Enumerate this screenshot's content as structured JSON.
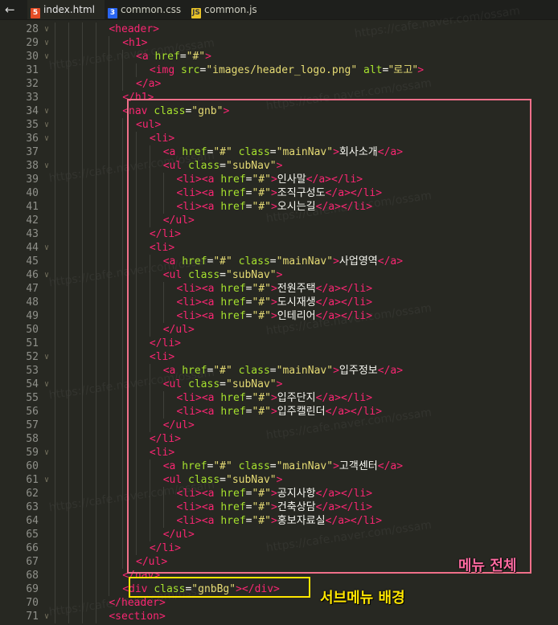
{
  "tabs": {
    "back_icon": "←",
    "items": [
      {
        "label": "index.html",
        "icon": "html-file-icon",
        "glyph": "5",
        "active": true
      },
      {
        "label": "common.css",
        "icon": "css-file-icon",
        "glyph": "3",
        "active": false
      },
      {
        "label": "common.js",
        "icon": "js-file-icon",
        "glyph": "JS",
        "active": false
      }
    ]
  },
  "editor": {
    "fold_glyph": "∨",
    "lines": [
      {
        "n": "28",
        "indent": 8,
        "fold": true,
        "tokens": [
          [
            "t",
            "<header>"
          ]
        ]
      },
      {
        "n": "29",
        "indent": 10,
        "fold": true,
        "tokens": [
          [
            "t",
            "<h1>"
          ]
        ]
      },
      {
        "n": "30",
        "indent": 12,
        "fold": true,
        "tokens": [
          [
            "t",
            "<a "
          ],
          [
            "a",
            "href"
          ],
          [
            "w",
            "="
          ],
          [
            "s",
            "\"#\""
          ],
          [
            "t",
            ">"
          ]
        ]
      },
      {
        "n": "31",
        "indent": 14,
        "fold": false,
        "tokens": [
          [
            "t",
            "<img "
          ],
          [
            "a",
            "src"
          ],
          [
            "w",
            "="
          ],
          [
            "s",
            "\"images/header_logo.png\""
          ],
          [
            "w",
            " "
          ],
          [
            "a",
            "alt"
          ],
          [
            "w",
            "="
          ],
          [
            "s",
            "\"로고\""
          ],
          [
            "t",
            ">"
          ]
        ]
      },
      {
        "n": "32",
        "indent": 12,
        "fold": false,
        "tokens": [
          [
            "t",
            "</a>"
          ]
        ]
      },
      {
        "n": "33",
        "indent": 10,
        "fold": false,
        "tokens": [
          [
            "t",
            "</h1>"
          ]
        ]
      },
      {
        "n": "34",
        "indent": 10,
        "fold": true,
        "tokens": [
          [
            "t",
            "<nav "
          ],
          [
            "a",
            "class"
          ],
          [
            "w",
            "="
          ],
          [
            "s",
            "\"gnb\""
          ],
          [
            "t",
            ">"
          ]
        ]
      },
      {
        "n": "35",
        "indent": 12,
        "fold": true,
        "tokens": [
          [
            "t",
            "<ul>"
          ]
        ]
      },
      {
        "n": "36",
        "indent": 14,
        "fold": true,
        "tokens": [
          [
            "t",
            "<li>"
          ]
        ]
      },
      {
        "n": "37",
        "indent": 16,
        "fold": false,
        "tokens": [
          [
            "t",
            "<a "
          ],
          [
            "a",
            "href"
          ],
          [
            "w",
            "="
          ],
          [
            "s",
            "\"#\""
          ],
          [
            "w",
            " "
          ],
          [
            "a",
            "class"
          ],
          [
            "w",
            "="
          ],
          [
            "s",
            "\"mainNav\""
          ],
          [
            "t",
            ">"
          ],
          [
            "w",
            "회사소개"
          ],
          [
            "t",
            "</a>"
          ]
        ]
      },
      {
        "n": "38",
        "indent": 16,
        "fold": true,
        "tokens": [
          [
            "t",
            "<ul "
          ],
          [
            "a",
            "class"
          ],
          [
            "w",
            "="
          ],
          [
            "s",
            "\"subNav\""
          ],
          [
            "t",
            ">"
          ]
        ]
      },
      {
        "n": "39",
        "indent": 18,
        "fold": false,
        "tokens": [
          [
            "t",
            "<li><a "
          ],
          [
            "a",
            "href"
          ],
          [
            "w",
            "="
          ],
          [
            "s",
            "\"#\""
          ],
          [
            "t",
            ">"
          ],
          [
            "w",
            "인사말"
          ],
          [
            "t",
            "</a></li>"
          ]
        ]
      },
      {
        "n": "40",
        "indent": 18,
        "fold": false,
        "tokens": [
          [
            "t",
            "<li><a "
          ],
          [
            "a",
            "href"
          ],
          [
            "w",
            "="
          ],
          [
            "s",
            "\"#\""
          ],
          [
            "t",
            ">"
          ],
          [
            "w",
            "조직구성도"
          ],
          [
            "t",
            "</a></li>"
          ]
        ]
      },
      {
        "n": "41",
        "indent": 18,
        "fold": false,
        "tokens": [
          [
            "t",
            "<li><a "
          ],
          [
            "a",
            "href"
          ],
          [
            "w",
            "="
          ],
          [
            "s",
            "\"#\""
          ],
          [
            "t",
            ">"
          ],
          [
            "w",
            "오시는길"
          ],
          [
            "t",
            "</a></li>"
          ]
        ]
      },
      {
        "n": "42",
        "indent": 16,
        "fold": false,
        "tokens": [
          [
            "t",
            "</ul>"
          ]
        ]
      },
      {
        "n": "43",
        "indent": 14,
        "fold": false,
        "tokens": [
          [
            "t",
            "</li>"
          ]
        ]
      },
      {
        "n": "44",
        "indent": 14,
        "fold": true,
        "tokens": [
          [
            "t",
            "<li>"
          ]
        ]
      },
      {
        "n": "45",
        "indent": 16,
        "fold": false,
        "tokens": [
          [
            "t",
            "<a "
          ],
          [
            "a",
            "href"
          ],
          [
            "w",
            "="
          ],
          [
            "s",
            "\"#\""
          ],
          [
            "w",
            " "
          ],
          [
            "a",
            "class"
          ],
          [
            "w",
            "="
          ],
          [
            "s",
            "\"mainNav\""
          ],
          [
            "t",
            ">"
          ],
          [
            "w",
            "사업영역"
          ],
          [
            "t",
            "</a>"
          ]
        ]
      },
      {
        "n": "46",
        "indent": 16,
        "fold": true,
        "tokens": [
          [
            "t",
            "<ul "
          ],
          [
            "a",
            "class"
          ],
          [
            "w",
            "="
          ],
          [
            "s",
            "\"subNav\""
          ],
          [
            "t",
            ">"
          ]
        ]
      },
      {
        "n": "47",
        "indent": 18,
        "fold": false,
        "tokens": [
          [
            "t",
            "<li><a "
          ],
          [
            "a",
            "href"
          ],
          [
            "w",
            "="
          ],
          [
            "s",
            "\"#\""
          ],
          [
            "t",
            ">"
          ],
          [
            "w",
            "전원주택"
          ],
          [
            "t",
            "</a></li>"
          ]
        ]
      },
      {
        "n": "48",
        "indent": 18,
        "fold": false,
        "tokens": [
          [
            "t",
            "<li><a "
          ],
          [
            "a",
            "href"
          ],
          [
            "w",
            "="
          ],
          [
            "s",
            "\"#\""
          ],
          [
            "t",
            ">"
          ],
          [
            "w",
            "도시재생"
          ],
          [
            "t",
            "</a></li>"
          ]
        ]
      },
      {
        "n": "49",
        "indent": 18,
        "fold": false,
        "tokens": [
          [
            "t",
            "<li><a "
          ],
          [
            "a",
            "href"
          ],
          [
            "w",
            "="
          ],
          [
            "s",
            "\"#\""
          ],
          [
            "t",
            ">"
          ],
          [
            "w",
            "인테리어"
          ],
          [
            "t",
            "</a></li>"
          ]
        ]
      },
      {
        "n": "50",
        "indent": 16,
        "fold": false,
        "tokens": [
          [
            "t",
            "</ul>"
          ]
        ]
      },
      {
        "n": "51",
        "indent": 14,
        "fold": false,
        "tokens": [
          [
            "t",
            "</li>"
          ]
        ]
      },
      {
        "n": "52",
        "indent": 14,
        "fold": true,
        "tokens": [
          [
            "t",
            "<li>"
          ]
        ]
      },
      {
        "n": "53",
        "indent": 16,
        "fold": false,
        "tokens": [
          [
            "t",
            "<a "
          ],
          [
            "a",
            "href"
          ],
          [
            "w",
            "="
          ],
          [
            "s",
            "\"#\""
          ],
          [
            "w",
            " "
          ],
          [
            "a",
            "class"
          ],
          [
            "w",
            "="
          ],
          [
            "s",
            "\"mainNav\""
          ],
          [
            "t",
            ">"
          ],
          [
            "w",
            "입주정보"
          ],
          [
            "t",
            "</a>"
          ]
        ]
      },
      {
        "n": "54",
        "indent": 16,
        "fold": true,
        "tokens": [
          [
            "t",
            "<ul "
          ],
          [
            "a",
            "class"
          ],
          [
            "w",
            "="
          ],
          [
            "s",
            "\"subNav\""
          ],
          [
            "t",
            ">"
          ]
        ]
      },
      {
        "n": "55",
        "indent": 18,
        "fold": false,
        "tokens": [
          [
            "t",
            "<li><a "
          ],
          [
            "a",
            "href"
          ],
          [
            "w",
            "="
          ],
          [
            "s",
            "\"#\""
          ],
          [
            "t",
            ">"
          ],
          [
            "w",
            "입주단지"
          ],
          [
            "t",
            "</a></li>"
          ]
        ]
      },
      {
        "n": "56",
        "indent": 18,
        "fold": false,
        "tokens": [
          [
            "t",
            "<li><a "
          ],
          [
            "a",
            "href"
          ],
          [
            "w",
            "="
          ],
          [
            "s",
            "\"#\""
          ],
          [
            "t",
            ">"
          ],
          [
            "w",
            "입주캘린더"
          ],
          [
            "t",
            "</a></li>"
          ]
        ]
      },
      {
        "n": "57",
        "indent": 16,
        "fold": false,
        "tokens": [
          [
            "t",
            "</ul>"
          ]
        ]
      },
      {
        "n": "58",
        "indent": 14,
        "fold": false,
        "tokens": [
          [
            "t",
            "</li>"
          ]
        ]
      },
      {
        "n": "59",
        "indent": 14,
        "fold": true,
        "tokens": [
          [
            "t",
            "<li>"
          ]
        ]
      },
      {
        "n": "60",
        "indent": 16,
        "fold": false,
        "tokens": [
          [
            "t",
            "<a "
          ],
          [
            "a",
            "href"
          ],
          [
            "w",
            "="
          ],
          [
            "s",
            "\"#\""
          ],
          [
            "w",
            " "
          ],
          [
            "a",
            "class"
          ],
          [
            "w",
            "="
          ],
          [
            "s",
            "\"mainNav\""
          ],
          [
            "t",
            ">"
          ],
          [
            "w",
            "고객센터"
          ],
          [
            "t",
            "</a>"
          ]
        ]
      },
      {
        "n": "61",
        "indent": 16,
        "fold": true,
        "tokens": [
          [
            "t",
            "<ul "
          ],
          [
            "a",
            "class"
          ],
          [
            "w",
            "="
          ],
          [
            "s",
            "\"subNav\""
          ],
          [
            "t",
            ">"
          ]
        ]
      },
      {
        "n": "62",
        "indent": 18,
        "fold": false,
        "tokens": [
          [
            "t",
            "<li><a "
          ],
          [
            "a",
            "href"
          ],
          [
            "w",
            "="
          ],
          [
            "s",
            "\"#\""
          ],
          [
            "t",
            ">"
          ],
          [
            "w",
            "공지사항"
          ],
          [
            "t",
            "</a></li>"
          ]
        ]
      },
      {
        "n": "63",
        "indent": 18,
        "fold": false,
        "tokens": [
          [
            "t",
            "<li><a "
          ],
          [
            "a",
            "href"
          ],
          [
            "w",
            "="
          ],
          [
            "s",
            "\"#\""
          ],
          [
            "t",
            ">"
          ],
          [
            "w",
            "건축상담"
          ],
          [
            "t",
            "</a></li>"
          ]
        ]
      },
      {
        "n": "64",
        "indent": 18,
        "fold": false,
        "tokens": [
          [
            "t",
            "<li><a "
          ],
          [
            "a",
            "href"
          ],
          [
            "w",
            "="
          ],
          [
            "s",
            "\"#\""
          ],
          [
            "t",
            ">"
          ],
          [
            "w",
            "홍보자료실"
          ],
          [
            "t",
            "</a></li>"
          ]
        ]
      },
      {
        "n": "65",
        "indent": 16,
        "fold": false,
        "tokens": [
          [
            "t",
            "</ul>"
          ]
        ]
      },
      {
        "n": "66",
        "indent": 14,
        "fold": false,
        "tokens": [
          [
            "t",
            "</li>"
          ]
        ]
      },
      {
        "n": "67",
        "indent": 12,
        "fold": false,
        "tokens": [
          [
            "t",
            "</ul>"
          ]
        ]
      },
      {
        "n": "68",
        "indent": 10,
        "fold": false,
        "tokens": [
          [
            "t",
            "</nav>"
          ]
        ]
      },
      {
        "n": "69",
        "indent": 10,
        "fold": false,
        "tokens": [
          [
            "t",
            "<div "
          ],
          [
            "a",
            "class"
          ],
          [
            "w",
            "="
          ],
          [
            "s",
            "\"gnbBg\""
          ],
          [
            "t",
            "></div>"
          ]
        ]
      },
      {
        "n": "70",
        "indent": 8,
        "fold": false,
        "tokens": [
          [
            "t",
            "</header>"
          ]
        ]
      },
      {
        "n": "71",
        "indent": 8,
        "fold": true,
        "tokens": [
          [
            "t",
            "<section>"
          ]
        ]
      }
    ]
  },
  "annotations": {
    "menu_label": "메뉴 전체",
    "menu_color": "#f0708a",
    "submenu_bg_label": "서브메뉴 배경",
    "submenu_bg_color": "#ffe600"
  },
  "watermark_text": "https://cafe.naver.com/ossam"
}
